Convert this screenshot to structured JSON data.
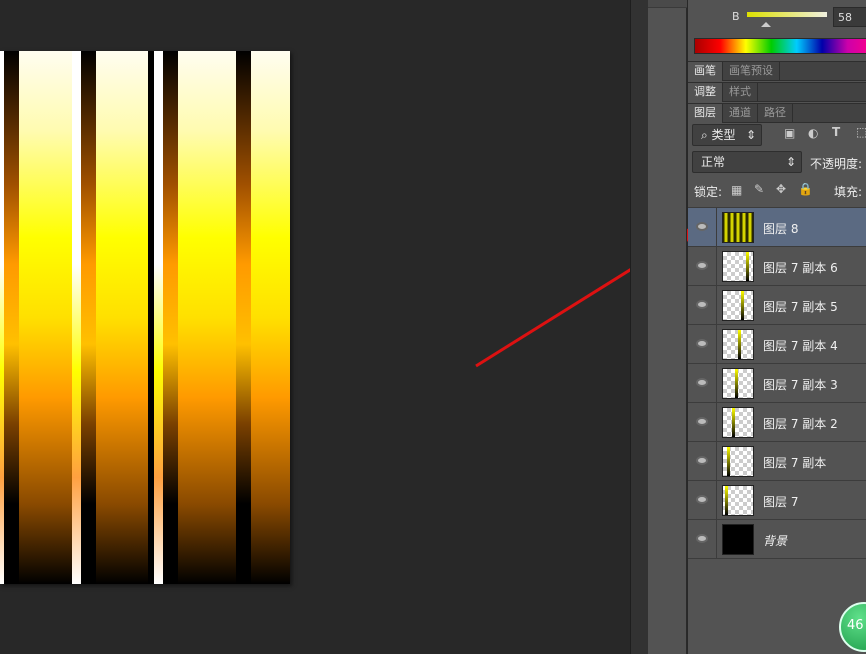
{
  "color_panel": {
    "channel_label": "B",
    "channel_value": "58"
  },
  "tabs_row1": [
    "画笔",
    "画笔预设"
  ],
  "tabs_row2": [
    "调整",
    "样式"
  ],
  "tabs_row3": [
    "图层",
    "通道",
    "路径"
  ],
  "filter": {
    "label": "类型",
    "icon": "search-icon"
  },
  "blend_mode": "正常",
  "opacity_label": "不透明度:",
  "lock_label": "锁定:",
  "fill_label": "填充:",
  "layers": [
    {
      "name": "图层 8",
      "selected": true
    },
    {
      "name": "图层 7 副本 6"
    },
    {
      "name": "图层 7 副本 5"
    },
    {
      "name": "图层 7 副本 4"
    },
    {
      "name": "图层 7 副本 3"
    },
    {
      "name": "图层 7 副本 2"
    },
    {
      "name": "图层 7 副本"
    },
    {
      "name": "图层 7"
    },
    {
      "name": "背景"
    }
  ],
  "badge": "46",
  "colors": {
    "annotation_arrow": "#dd1111",
    "selected_row": "#5b6a82"
  }
}
